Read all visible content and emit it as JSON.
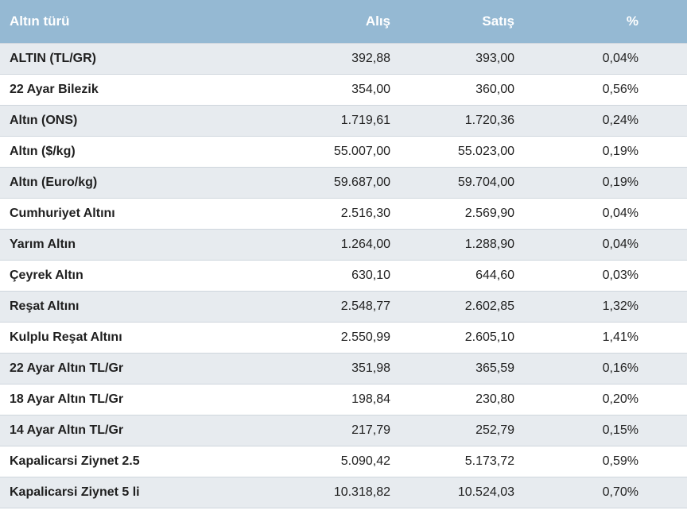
{
  "table": {
    "headers": {
      "name": "Altın türü",
      "buy": "Alış",
      "sell": "Satış",
      "change": "%"
    },
    "rows": [
      {
        "name": "ALTIN (TL/GR)",
        "buy": "392,88",
        "sell": "393,00",
        "change": "0,04%"
      },
      {
        "name": "22 Ayar Bilezik",
        "buy": "354,00",
        "sell": "360,00",
        "change": "0,56%"
      },
      {
        "name": "Altın (ONS)",
        "buy": "1.719,61",
        "sell": "1.720,36",
        "change": "0,24%"
      },
      {
        "name": "Altın ($/kg)",
        "buy": "55.007,00",
        "sell": "55.023,00",
        "change": "0,19%"
      },
      {
        "name": "Altın (Euro/kg)",
        "buy": "59.687,00",
        "sell": "59.704,00",
        "change": "0,19%"
      },
      {
        "name": "Cumhuriyet Altını",
        "buy": "2.516,30",
        "sell": "2.569,90",
        "change": "0,04%"
      },
      {
        "name": "Yarım Altın",
        "buy": "1.264,00",
        "sell": "1.288,90",
        "change": "0,04%"
      },
      {
        "name": "Çeyrek Altın",
        "buy": "630,10",
        "sell": "644,60",
        "change": "0,03%"
      },
      {
        "name": "Reşat Altını",
        "buy": "2.548,77",
        "sell": "2.602,85",
        "change": "1,32%"
      },
      {
        "name": "Kulplu Reşat Altını",
        "buy": "2.550,99",
        "sell": "2.605,10",
        "change": "1,41%"
      },
      {
        "name": "22 Ayar Altın TL/Gr",
        "buy": "351,98",
        "sell": "365,59",
        "change": "0,16%"
      },
      {
        "name": "18 Ayar Altın TL/Gr",
        "buy": "198,84",
        "sell": "230,80",
        "change": "0,20%"
      },
      {
        "name": "14 Ayar Altın TL/Gr",
        "buy": "217,79",
        "sell": "252,79",
        "change": "0,15%"
      },
      {
        "name": "Kapalicarsi Ziynet 2.5",
        "buy": "5.090,42",
        "sell": "5.173,72",
        "change": "0,59%"
      },
      {
        "name": "Kapalicarsi Ziynet 5 li",
        "buy": "10.318,82",
        "sell": "10.524,03",
        "change": "0,70%"
      }
    ]
  },
  "colors": {
    "header_bg": "#95b9d3",
    "row_alt_bg": "#e7ebef",
    "row_bg": "#ffffff"
  }
}
